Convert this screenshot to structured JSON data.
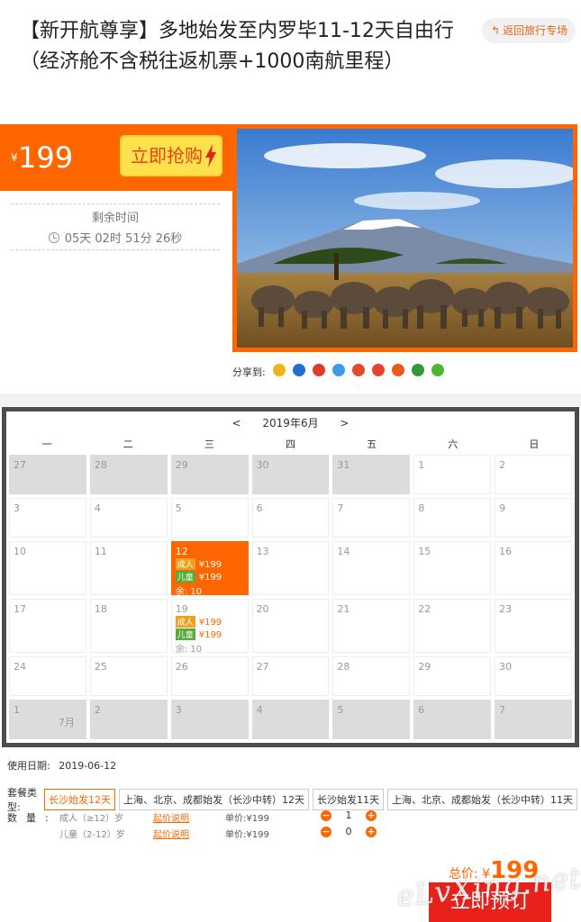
{
  "title": "【新开航尊享】多地始发至内罗毕11-12天自由行（经济舱不含税往返机票+1000南航里程）",
  "back_button": "返回旅行专场",
  "promo": {
    "currency": "¥",
    "price": "199",
    "buy_label": "立即抢购",
    "countdown_label": "剩余时间",
    "countdown_value": "05天 02时 51分 26秒"
  },
  "share_label": "分享到:",
  "share_icons": [
    {
      "name": "qzone-icon",
      "color": "#f2b21b"
    },
    {
      "name": "baidu-icon",
      "color": "#1f6fd1"
    },
    {
      "name": "weibo-icon",
      "color": "#e03a2e"
    },
    {
      "name": "qq-icon",
      "color": "#3c9be8"
    },
    {
      "name": "renren-icon",
      "color": "#e24a2b"
    },
    {
      "name": "kaixin-icon",
      "color": "#e3432f"
    },
    {
      "name": "taobao-icon",
      "color": "#ea5a18"
    },
    {
      "name": "douban-icon",
      "color": "#2e9a39"
    },
    {
      "name": "wechat-icon",
      "color": "#52b531"
    }
  ],
  "calendar": {
    "prev": "<",
    "month": "2019年6月",
    "next": ">",
    "weekdays": [
      "一",
      "二",
      "三",
      "四",
      "五",
      "六",
      "日"
    ],
    "rows": [
      [
        {
          "d": "27",
          "g": true
        },
        {
          "d": "28",
          "g": true
        },
        {
          "d": "29",
          "g": true
        },
        {
          "d": "30",
          "g": true
        },
        {
          "d": "31",
          "g": true
        },
        {
          "d": "1"
        },
        {
          "d": "2"
        }
      ],
      [
        {
          "d": "3"
        },
        {
          "d": "4"
        },
        {
          "d": "5"
        },
        {
          "d": "6"
        },
        {
          "d": "7"
        },
        {
          "d": "8"
        },
        {
          "d": "9"
        }
      ],
      [
        {
          "d": "10"
        },
        {
          "d": "11"
        },
        {
          "d": "12",
          "sel": true,
          "adult": "成人",
          "adult_price": "¥199",
          "child": "儿童",
          "child_price": "¥199",
          "left": "余: 10"
        },
        {
          "d": "13"
        },
        {
          "d": "14"
        },
        {
          "d": "15"
        },
        {
          "d": "16"
        }
      ],
      [
        {
          "d": "17"
        },
        {
          "d": "18"
        },
        {
          "d": "19",
          "adult": "成人",
          "adult_price": "¥199",
          "child": "儿童",
          "child_price": "¥199",
          "left": "余: 10"
        },
        {
          "d": "20"
        },
        {
          "d": "21"
        },
        {
          "d": "22"
        },
        {
          "d": "23"
        }
      ],
      [
        {
          "d": "24"
        },
        {
          "d": "25"
        },
        {
          "d": "26"
        },
        {
          "d": "27"
        },
        {
          "d": "28"
        },
        {
          "d": "29"
        },
        {
          "d": "30"
        }
      ],
      [
        {
          "d": "1",
          "g": true,
          "m": "7月"
        },
        {
          "d": "2",
          "g": true
        },
        {
          "d": "3",
          "g": true
        },
        {
          "d": "4",
          "g": true
        },
        {
          "d": "5",
          "g": true
        },
        {
          "d": "6",
          "g": true
        },
        {
          "d": "7",
          "g": true
        }
      ]
    ]
  },
  "booking": {
    "use_date_label": "使用日期:",
    "use_date": "2019-06-12",
    "package_label": "套餐类型:",
    "packages": [
      "长沙始发12天",
      "上海、北京、成都始发（长沙中转）12天",
      "长沙始发11天",
      "上海、北京、成都始发（长沙中转）11天"
    ],
    "qty_label": "数量:",
    "adult_label": "成人（≥12）岁",
    "child_label": "儿童（2-12）岁",
    "price_note": "起价说明",
    "adult_unit": "单价:¥199",
    "child_unit": "单价:¥199",
    "adult_qty": "1",
    "child_qty": "0",
    "minus": "−",
    "plus": "+"
  },
  "total": {
    "label": "总价: ¥",
    "value": "199"
  },
  "book_label": "立即预订",
  "watermark": "eLvXing.net"
}
